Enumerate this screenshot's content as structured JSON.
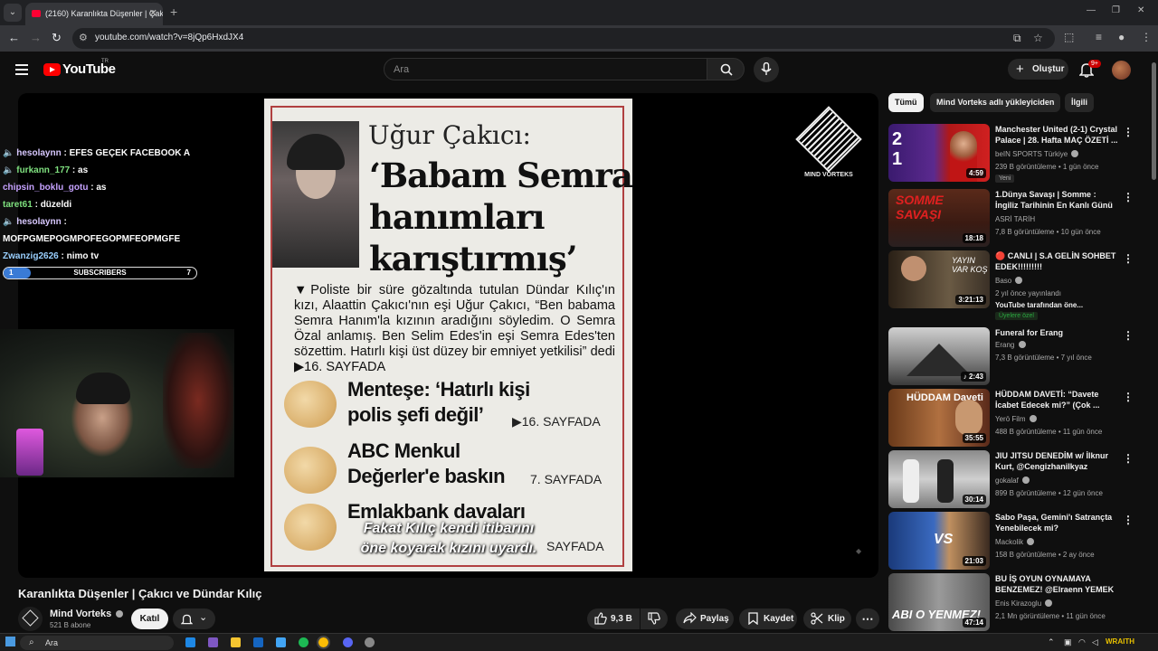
{
  "browser": {
    "tab_title": "(2160) Karanlıkta Düşenler | Çakıcı",
    "url": "youtube.com/watch?v=8jQp6HxdJX4"
  },
  "header": {
    "logo_text": "YouTube",
    "country_code": "TR",
    "search_placeholder": "Ara",
    "create_label": "Oluştur",
    "notification_badge": "9+"
  },
  "stream_overlay": {
    "chat": [
      {
        "user": "hesolaynn",
        "message": "EFES GEÇEK FACEBOOK A"
      },
      {
        "user": "furkann_177",
        "message": "as"
      },
      {
        "user": "chipsin_boklu_gotu",
        "message": "as"
      },
      {
        "user": "taret61",
        "message": "düzeldi"
      },
      {
        "user": "hesolaynn",
        "message": ""
      },
      {
        "user": "",
        "message": "MOFPGMEPOGMPOFEGOPMFEOPMGFE"
      },
      {
        "user": "Zwanzig2626",
        "message": "nimo tv"
      }
    ],
    "subs_bar": {
      "label": "SUBSCRIBERS",
      "current": "1",
      "goal": "7",
      "fraction": 0.14
    },
    "subtitle_line1": "Fakat Kılıç kendi itibarını",
    "subtitle_line2": "öne koyarak kızını uyardı.",
    "channel_logo_text": "MIND VORTEKS"
  },
  "newspaper": {
    "byline": "Uğur Çakıcı:",
    "headline": [
      "‘Babam Semra",
      "hanımları",
      "karıştırmış’"
    ],
    "lead": "▼Poliste bir süre gözaltında tutulan Dündar Kılıç'ın kızı, Alaattin Çakıcı'nın eşi Uğur Çakıcı, “Ben babama Semra Hanım'la kızının aradığını söyledim. O Semra Özal anlamış. Ben Selim Edes'in eşi Semra Edes'ten sözettim. Hatırlı kişi üst düzey bir emniyet yetkilisi” dedi",
    "lead_ref": "▶16. SAYFADA",
    "items": [
      {
        "line1": "Menteşe: ‘Hatırlı kişi",
        "line2": "polis şefi değil’",
        "page": "▶16. SAYFADA"
      },
      {
        "line1": "ABC Menkul",
        "line2": "Değerler'e baskın",
        "page": "7. SAYFADA"
      },
      {
        "line1": "Emlakbank davaları",
        "line2": "",
        "page": "SAYFADA"
      }
    ]
  },
  "video": {
    "title": "Karanlıkta Düşenler | Çakıcı ve Dündar Kılıç",
    "channel": "Mind Vorteks",
    "subscribers": "521 B abone",
    "join_label": "Katıl",
    "likes": "9,3 B",
    "share_label": "Paylaş",
    "save_label": "Kaydet",
    "clip_label": "Klip"
  },
  "sidebar": {
    "chips": [
      "Tümü",
      "Mind Vorteks adlı yükleyiciden",
      "İlgili"
    ],
    "videos": [
      {
        "title": "Manchester United (2-1) Crystal Palace | 28. Hafta MAÇ ÖZETİ ...",
        "channel": "beIN SPORTS Türkiye",
        "meta": "239 B görüntüleme • 1 gün önce",
        "tag": "Yeni",
        "duration": "4:59"
      },
      {
        "title": "1.Dünya Savaşı | Somme : İngiliz Tarihinin En Kanlı Günü ...",
        "channel": "ASRİ TARİH",
        "meta": "7,8 B görüntüleme • 10 gün önce",
        "tag": "",
        "duration": "18:18"
      },
      {
        "title": "🔴 CANLI | S.A GELİN SOHBET EDEK!!!!!!!!!",
        "channel": "Baso",
        "meta": "2 yıl önce yayınlandı",
        "extra": "YouTube tarafından öne...",
        "tag": "Üyelere özel",
        "duration": "3:21:13"
      },
      {
        "title": "Funeral for Erang",
        "channel": "Erang",
        "meta": "7,3 B görüntüleme • 7 yıl önce",
        "tag": "",
        "duration": "2:43"
      },
      {
        "title": "HÜDDAM DAVETİ: “Davete İcabet Edecek mi?” (Çok ...",
        "channel": "Yerö Film",
        "meta": "488 B görüntüleme • 11 gün önce",
        "tag": "",
        "duration": "35:55"
      },
      {
        "title": "JIU JITSU DENEDİM w/ İlknur Kurt, @Cengizhanilkyaz",
        "channel": "gokalaf",
        "meta": "899 B görüntüleme • 12 gün önce",
        "tag": "",
        "duration": "30:14"
      },
      {
        "title": "Sabo Paşa, Gemini'ı Satrançta Yenebilecek mi?",
        "channel": "Mackolik",
        "meta": "158 B görüntüleme • 2 ay önce",
        "tag": "",
        "duration": "21:03"
      },
      {
        "title": "BU İŞ OYUN OYNAMAYA BENZEMEZ! @Elraenn YEMEK ...",
        "channel": "Enis Kirazoglu",
        "meta": "2,1 Mn görüntüleme • 11 gün önce",
        "tag": "",
        "duration": "47:14"
      }
    ]
  },
  "taskbar": {
    "search_label": "Ara",
    "tray_text": "WRAITH"
  },
  "colors": {
    "accent_red": "#ff0000",
    "background": "#0f0f0f",
    "chip_bg": "#272727"
  }
}
